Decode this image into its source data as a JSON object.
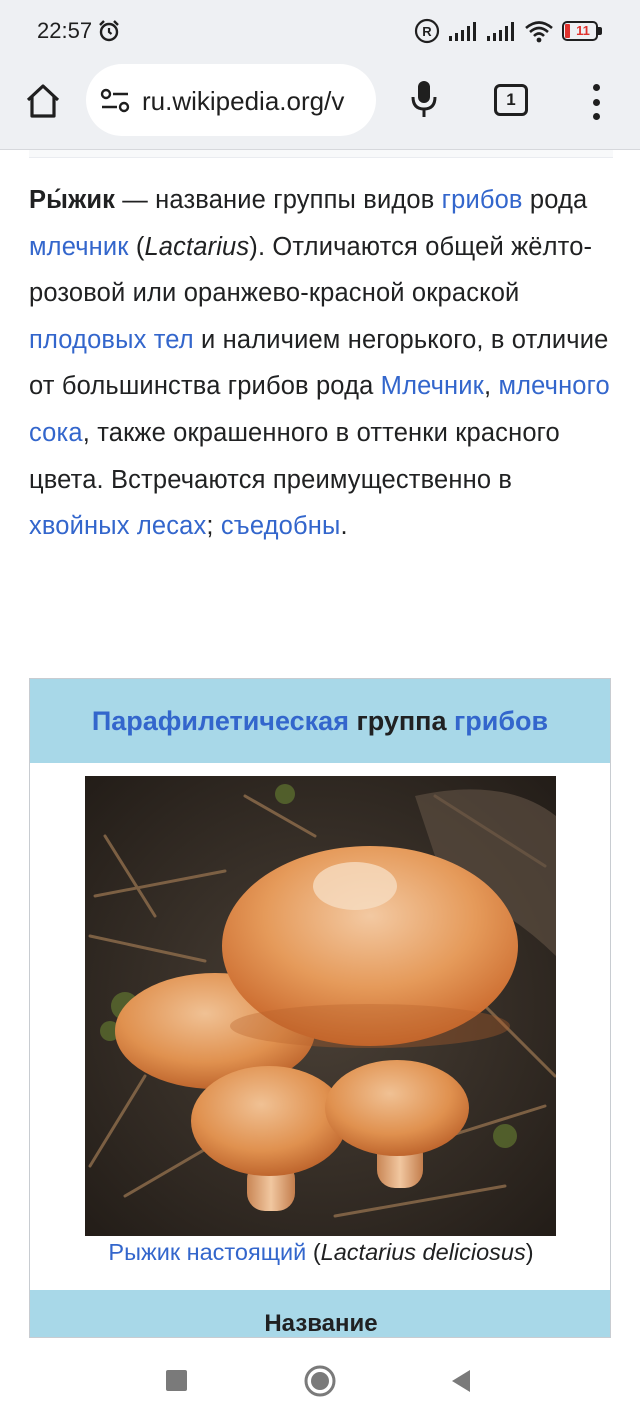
{
  "status_bar": {
    "time": "22:57",
    "battery_level": "11",
    "icons": [
      "alarm-icon",
      "registered-icon",
      "signal-icon",
      "signal-icon",
      "wifi-icon",
      "battery-icon"
    ]
  },
  "browser": {
    "url": "ru.wikipedia.org/v",
    "tab_count": "1",
    "icons": [
      "home-icon",
      "site-settings-icon",
      "mic-icon",
      "tabs-icon",
      "more-vert-icon"
    ]
  },
  "article": {
    "lead": {
      "title": "Ры́жик",
      "t1": " — название группы видов ",
      "l1": "грибов",
      "t2": " рода ",
      "l2": "млечник",
      "t3": " (",
      "latin": "Lactarius",
      "t4": "). Отличаются общей жёлто-розовой или оранжево-красной окраской ",
      "l3": "плодовых тел",
      "t5": " и наличием негорького, в отличие от большинства грибов рода ",
      "l4": "Млечник",
      "t6": ", ",
      "l5": "млечного сока",
      "t7": ", также окрашенного в оттенки красного цвета. Встречаются преимущественно в ",
      "l6": "хвойных лесах",
      "t8": "; ",
      "l7": "съедобны",
      "t9": "."
    }
  },
  "infobox": {
    "header_link1": "Парафилетическая",
    "header_text": " группа ",
    "header_link2": "грибов",
    "caption_link": "Рыжик настоящий",
    "caption_open": " (",
    "caption_latin": "Lactarius deliciosus",
    "caption_close": ")",
    "section_title": "Название"
  },
  "nav": {
    "icons": [
      "recents-square-icon",
      "home-circle-icon",
      "back-triangle-icon"
    ]
  },
  "colors": {
    "link": "#3366cc",
    "infobox_header": "#a8d8e8",
    "chrome_bg": "#eef0f3"
  }
}
